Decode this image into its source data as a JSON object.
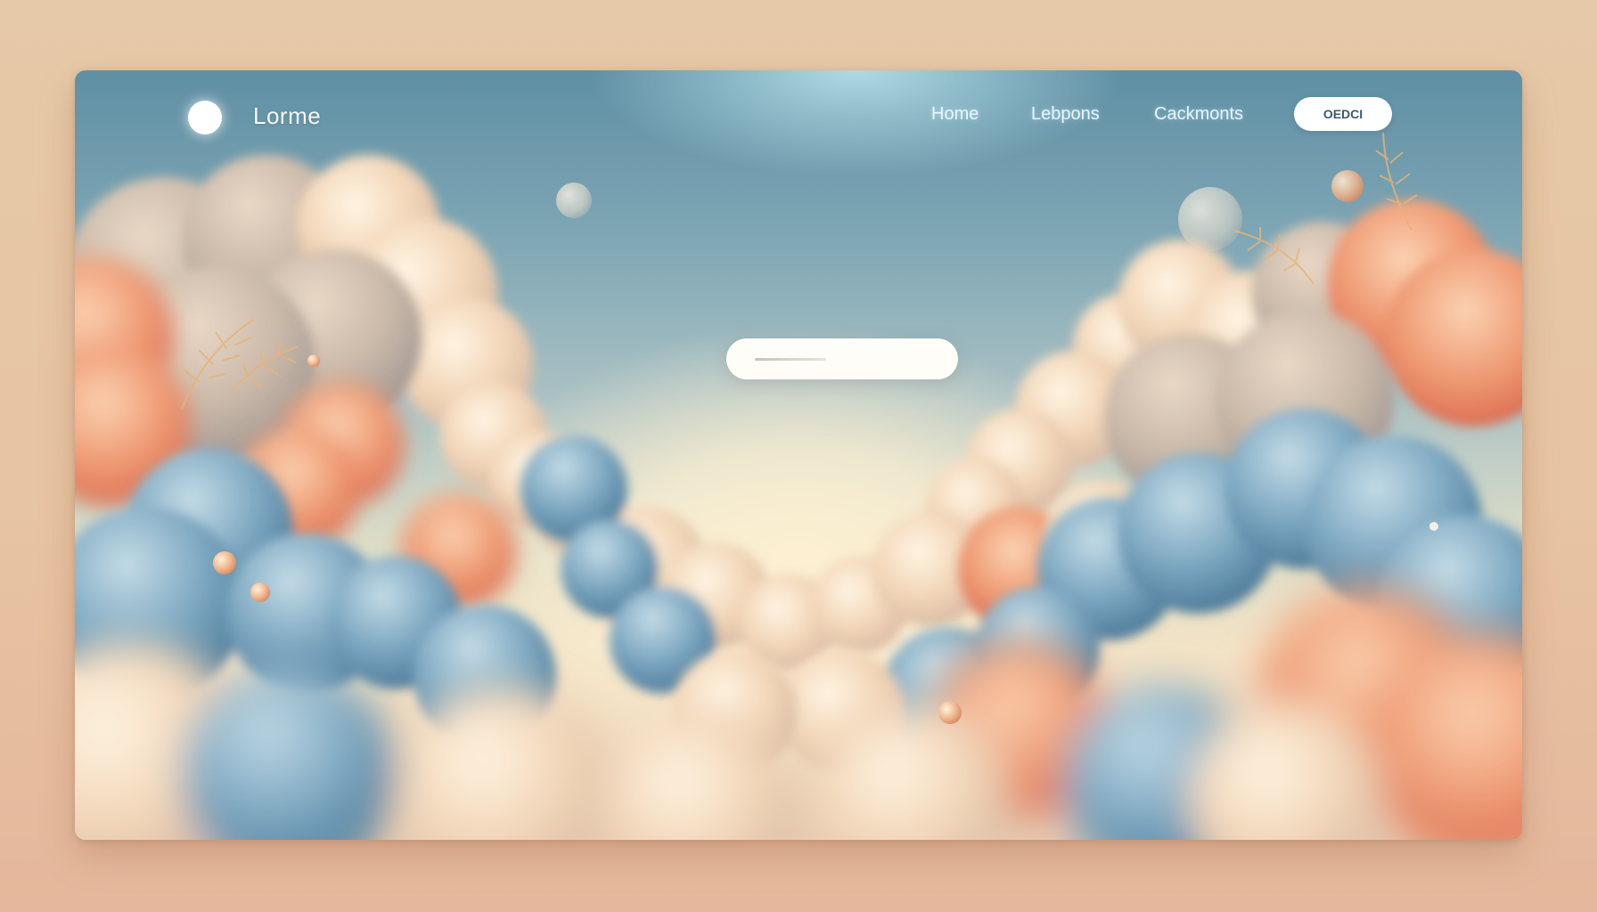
{
  "header": {
    "brand": "Lorme",
    "nav": [
      "Home",
      "Lebpons",
      "Cackmonts"
    ],
    "cta_label": "OEDCI"
  },
  "hero": {
    "title": "",
    "search_placeholder": ""
  },
  "colors": {
    "sky_top": "#5f8fa4",
    "sky_glow": "#fdf0d2",
    "cloud_blue": "#6f9dba",
    "cloud_peach": "#f3d2b0",
    "cloud_coral": "#ec8e6c",
    "page_bg": "#e6c9a8"
  },
  "icons": [
    "logo-circle-icon",
    "search-bar-icon"
  ]
}
